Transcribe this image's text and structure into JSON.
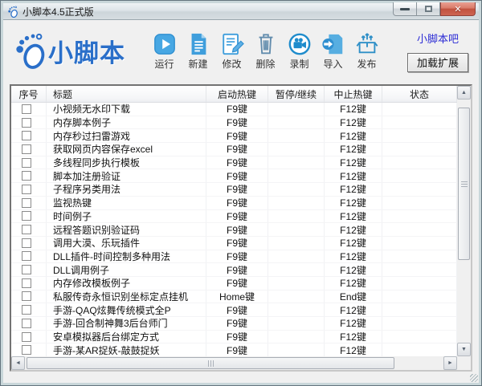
{
  "window": {
    "title": "小脚本4.5正式版"
  },
  "icons": {
    "close": "✕",
    "scroll_up": "▲",
    "scroll_down": "▼",
    "scroll_left": "◄",
    "scroll_right": "►"
  },
  "colors": {
    "brand_blue": "#2a6fc9",
    "toolbar_icon_blue": "#3f9edc",
    "link_blue": "#2b2bd5",
    "close_red": "#c1523f"
  },
  "branding": {
    "logo_text": "小脚本",
    "forum_link": "小脚本吧",
    "load_extension_button": "加载扩展"
  },
  "toolbar": {
    "items": [
      {
        "icon": "run-icon",
        "label": "运行"
      },
      {
        "icon": "new-icon",
        "label": "新建"
      },
      {
        "icon": "edit-icon",
        "label": "修改"
      },
      {
        "icon": "delete-icon",
        "label": "删除"
      },
      {
        "icon": "record-icon",
        "label": "录制"
      },
      {
        "icon": "import-icon",
        "label": "导入"
      },
      {
        "icon": "publish-icon",
        "label": "发布"
      }
    ]
  },
  "table": {
    "headers": {
      "seq": "序号",
      "title": "标题",
      "start": "启动热键",
      "pause": "暂停/继续",
      "stop": "中止热键",
      "status": "状态"
    },
    "rows": [
      {
        "title": "小视频无水印下载",
        "start": "F9键",
        "pause": "",
        "stop": "F12键",
        "status": ""
      },
      {
        "title": "内存脚本例子",
        "start": "F9键",
        "pause": "",
        "stop": "F12键",
        "status": ""
      },
      {
        "title": "内存秒过扫雷游戏",
        "start": "F9键",
        "pause": "",
        "stop": "F12键",
        "status": ""
      },
      {
        "title": "获取网页内容保存excel",
        "start": "F9键",
        "pause": "",
        "stop": "F12键",
        "status": ""
      },
      {
        "title": "多线程同步执行模板",
        "start": "F9键",
        "pause": "",
        "stop": "F12键",
        "status": ""
      },
      {
        "title": "脚本加注册验证",
        "start": "F9键",
        "pause": "",
        "stop": "F12键",
        "status": ""
      },
      {
        "title": "子程序另类用法",
        "start": "F9键",
        "pause": "",
        "stop": "F12键",
        "status": ""
      },
      {
        "title": "监视热键",
        "start": "F9键",
        "pause": "",
        "stop": "F12键",
        "status": ""
      },
      {
        "title": "时间例子",
        "start": "F9键",
        "pause": "",
        "stop": "F12键",
        "status": ""
      },
      {
        "title": "远程答题识别验证码",
        "start": "F9键",
        "pause": "",
        "stop": "F12键",
        "status": ""
      },
      {
        "title": "调用大漠、乐玩插件",
        "start": "F9键",
        "pause": "",
        "stop": "F12键",
        "status": ""
      },
      {
        "title": "DLL插件-时间控制多种用法",
        "start": "F9键",
        "pause": "",
        "stop": "F12键",
        "status": ""
      },
      {
        "title": "DLL调用例子",
        "start": "F9键",
        "pause": "",
        "stop": "F12键",
        "status": ""
      },
      {
        "title": "内存修改模板例子",
        "start": "F9键",
        "pause": "",
        "stop": "F12键",
        "status": ""
      },
      {
        "title": "私服传奇永恒识别坐标定点挂机",
        "start": "Home键",
        "pause": "",
        "stop": "End键",
        "status": ""
      },
      {
        "title": "手游-QAQ炫舞传统模式全P",
        "start": "F9键",
        "pause": "",
        "stop": "F12键",
        "status": ""
      },
      {
        "title": "手游-回合制神舞3后台师门",
        "start": "F9键",
        "pause": "",
        "stop": "F12键",
        "status": ""
      },
      {
        "title": "安卓模拟器后台绑定方式",
        "start": "F9键",
        "pause": "",
        "stop": "F12键",
        "status": ""
      },
      {
        "title": "手游-某AR捉妖-敲鼓捉妖",
        "start": "F9键",
        "pause": "",
        "stop": "F12键",
        "status": ""
      }
    ]
  }
}
